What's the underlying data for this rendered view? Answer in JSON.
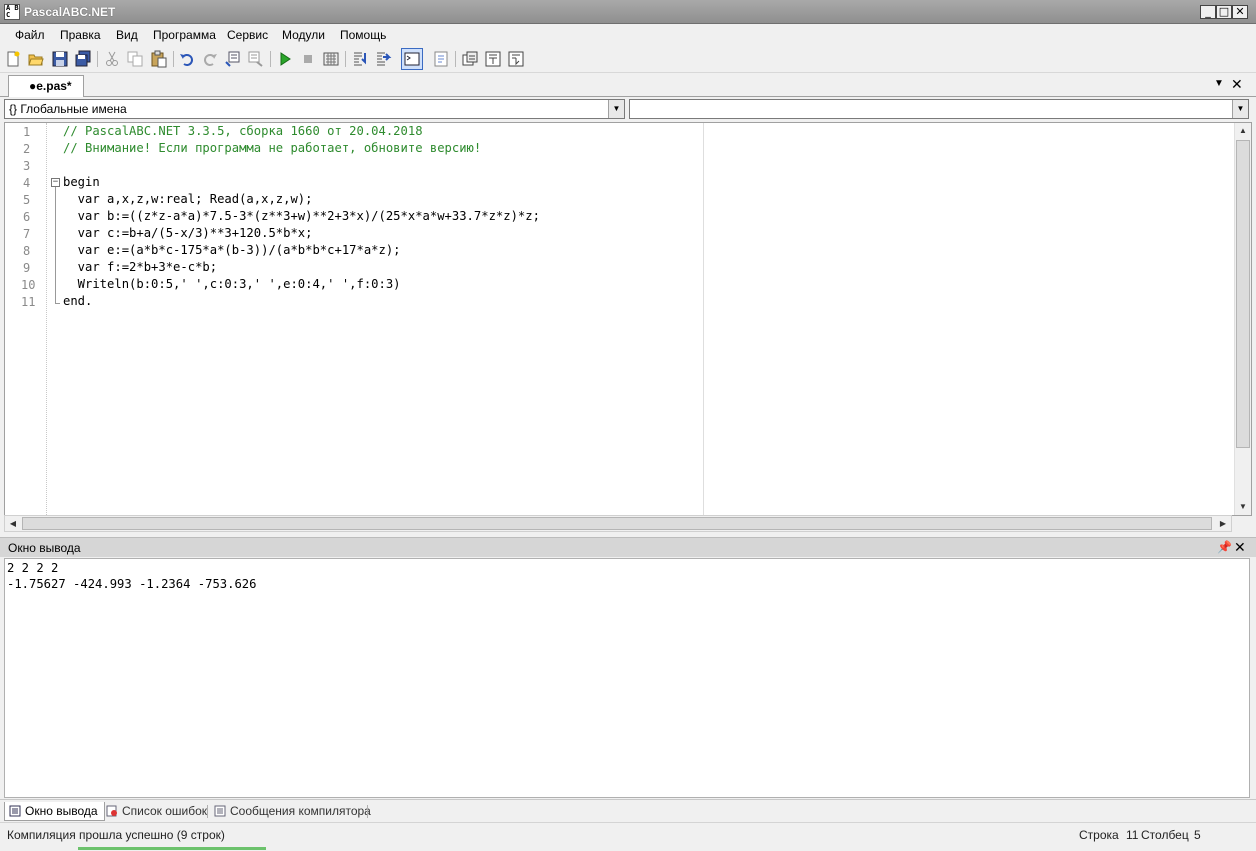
{
  "window": {
    "title": "PascalABC.NET",
    "icon": "pascal-app-icon"
  },
  "menu": [
    "Файл",
    "Правка",
    "Вид",
    "Программа",
    "Сервис",
    "Модули",
    "Помощь"
  ],
  "toolbar": {
    "icons": [
      "new-file-icon",
      "open-file-icon",
      "save-icon",
      "save-all-icon",
      "cut-icon",
      "copy-icon",
      "paste-icon",
      "undo-icon",
      "redo-icon",
      "comment-icon",
      "uncomment-icon",
      "run-icon",
      "stop-icon",
      "compile-icon",
      "step-into-icon",
      "step-over-icon",
      "output-window-icon",
      "debug-toggle-icon",
      "format-icon",
      "bookmark-1-icon",
      "bookmark-2-icon",
      "bookmark-3-icon"
    ]
  },
  "editor_tab": {
    "label": "●e.pas*"
  },
  "scope": {
    "left": "{} Глобальные имена",
    "right": ""
  },
  "code": {
    "line_numbers": [
      "1",
      "2",
      "3",
      "4",
      "5",
      "6",
      "7",
      "8",
      "9",
      "10",
      "11"
    ],
    "lines": [
      "// PascalABC.NET 3.3.5, сборка 1660 от 20.04.2018",
      "// Внимание! Если программа не работает, обновите версию!",
      "",
      "begin",
      "  var a,x,z,w:real; Read(a,x,z,w);",
      "  var b:=((z*z-a*a)*7.5-3*(z**3+w)**2+3*x)/(25*x*a*w+33.7*z*z)*z;",
      "  var c:=b+a/(5-x/3)**3+120.5*b*x;",
      "  var e:=(a*b*c-175*a*(b-3))/(a*b*b*c+17*a*z);",
      "  var f:=2*b+3*e-c*b;",
      "  Writeln(b:0:5,' ',c:0:3,' ',e:0:4,' ',f:0:3)",
      "end."
    ]
  },
  "output_panel": {
    "title": "Окно вывода",
    "lines": [
      "2 2 2 2",
      "-1.75627 -424.993 -1.2364 -753.626"
    ]
  },
  "bottom_tabs": [
    "Окно вывода",
    "Список ошибок",
    "Сообщения компилятора"
  ],
  "status": {
    "message": "Компиляция прошла успешно (9 строк)",
    "row_label": "Строка",
    "row": "11",
    "col_label": "Столбец",
    "col": "5"
  },
  "colors": {
    "comment": "#2e8b2e",
    "title_bar": "#9c9c9c",
    "chrome": "#f0f0f0"
  }
}
